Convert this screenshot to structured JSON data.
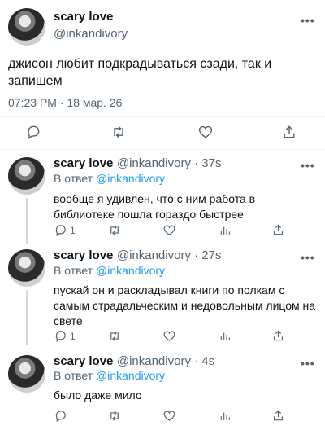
{
  "main_tweet": {
    "author_name": "scary love",
    "author_handle": "@inkandivory",
    "more_label": "•••",
    "text_line1": "джисон любит подкрадываться сзади, так и",
    "text_line2": "запишем",
    "timestamp": "07:23 PM · 18 мар. 26"
  },
  "replies": [
    {
      "author_name": "scary love",
      "author_handle": "@inkandivory · 37s",
      "reply_prefix": "В ответ",
      "reply_to": "@inkandivory",
      "text_line1": "вообще я удивлен, что с ним работа в",
      "text_line2": "библиотеке пошла гораздо быстрее",
      "text_line3": "",
      "reply_count": "1",
      "more_label": "•••"
    },
    {
      "author_name": "scary love",
      "author_handle": "@inkandivory · 27s",
      "reply_prefix": "В ответ",
      "reply_to": "@inkandivory",
      "text_line1": "пускай он и раскладывал книги по полкам с",
      "text_line2": "самым страдальческим и недовольным лицом на",
      "text_line3": "свете",
      "reply_count": "1",
      "more_label": "•••"
    },
    {
      "author_name": "scary love",
      "author_handle": "@inkandivory · 4s",
      "reply_prefix": "В ответ",
      "reply_to": "@inkandivory",
      "text_line1": "было даже мило",
      "text_line2": "",
      "text_line3": "",
      "reply_count": "",
      "more_label": "•••"
    }
  ],
  "colors": {
    "accent": "#1d9bf0",
    "muted": "#536471",
    "text": "#0f1419"
  },
  "icons": [
    "reply-icon",
    "retweet-icon",
    "like-icon",
    "share-icon",
    "views-icon"
  ]
}
